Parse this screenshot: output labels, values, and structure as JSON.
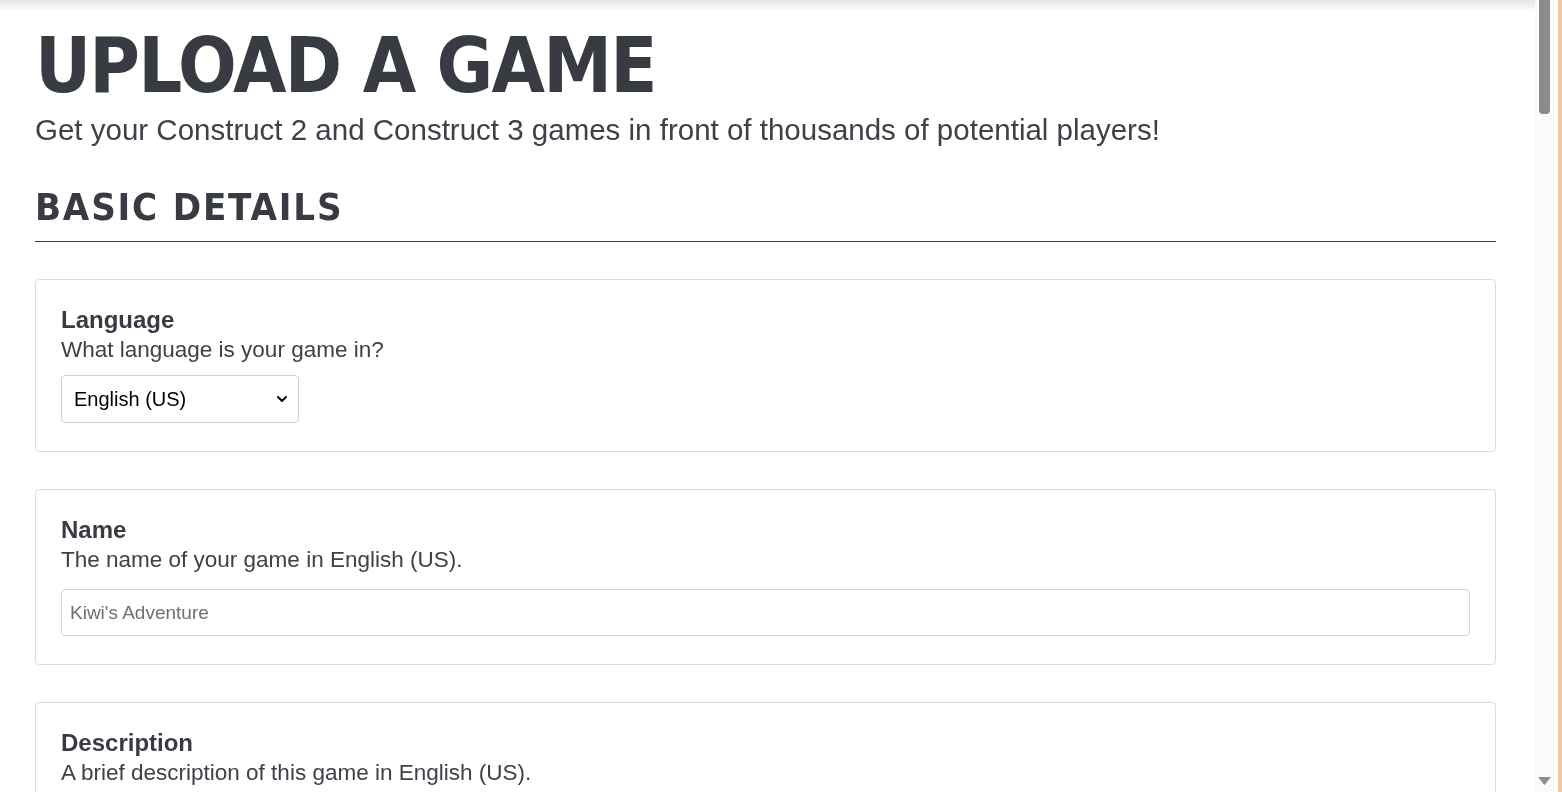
{
  "page": {
    "title": "UPLOAD A GAME",
    "subtitle": "Get your Construct 2 and Construct 3 games in front of thousands of potential players!"
  },
  "section": {
    "title": "BASIC DETAILS"
  },
  "fields": [
    {
      "kind": "select",
      "label": "Language",
      "hint": "What language is your game in?",
      "value": "English (US)"
    },
    {
      "kind": "text",
      "label": "Name",
      "hint": "The name of your game in English (US).",
      "placeholder": "Kiwi's Adventure"
    },
    {
      "kind": "none",
      "label": "Description",
      "hint": "A brief description of this game in English (US)."
    }
  ]
}
